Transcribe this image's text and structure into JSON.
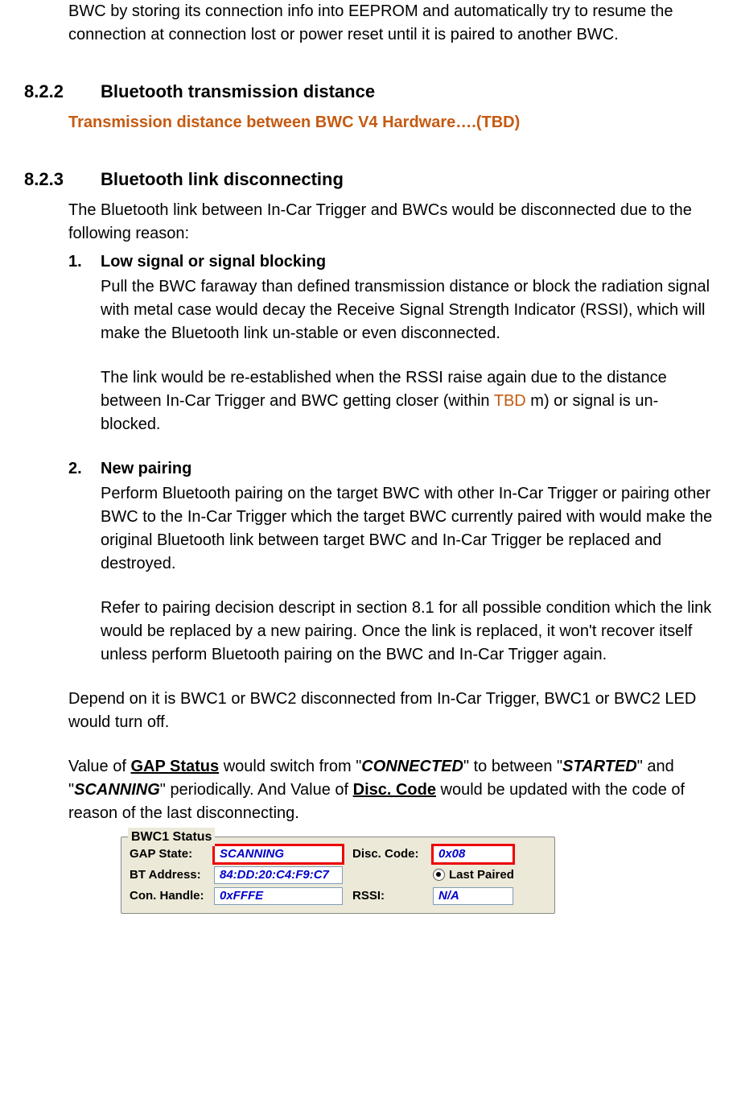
{
  "intro_tail": "BWC by storing its connection info into EEPROM and automatically try to resume the connection at connection lost or power reset until it is paired to another BWC.",
  "s822": {
    "num": "8.2.2",
    "title": "Bluetooth transmission distance",
    "orange": "Transmission distance between BWC V4 Hardware….(TBD)"
  },
  "s823": {
    "num": "8.2.3",
    "title": "Bluetooth link disconnecting",
    "lead": "The Bluetooth link between In-Car Trigger and BWCs would be disconnected due to the following reason:",
    "i1": {
      "num": "1.",
      "title": "Low signal or signal blocking",
      "p1": "Pull the BWC faraway than defined transmission distance or block the radiation signal with metal case would decay the Receive Signal Strength Indicator (RSSI), which will make the Bluetooth link un-stable or even disconnected.",
      "p2a": "The link would be re-established when the RSSI raise again due to the distance between In-Car Trigger and BWC getting closer (within ",
      "p2tbd": "TBD",
      "p2b": " m) or signal is un-blocked."
    },
    "i2": {
      "num": "2.",
      "title": "New pairing",
      "p1": "Perform Bluetooth pairing on the target BWC with other In-Car Trigger or pairing other BWC to the In-Car Trigger which the target BWC currently paired with would make the original Bluetooth link between target BWC and In-Car Trigger be replaced and destroyed.",
      "p2": "Refer to pairing decision descript in section 8.1 for all possible condition which the link would be replaced by a new pairing. Once the link is replaced, it won't recover itself unless perform Bluetooth pairing on the BWC and In-Car Trigger again."
    },
    "after1": "Depend on it is BWC1 or BWC2 disconnected from In-Car Trigger, BWC1 or BWC2 LED would turn off.",
    "after2": {
      "a": "Value of ",
      "gap": "GAP Status",
      "b": " would switch from \"",
      "connected": "CONNECTED",
      "c": "\" to between \"",
      "started": "STARTED",
      "d": "\" and \"",
      "scanning": "SCANNING",
      "e": "\" periodically. And Value of ",
      "disc": "Disc. Code",
      "f": " would be updated with the code of reason of the last disconnecting."
    }
  },
  "status": {
    "legend": "BWC1 Status",
    "l_gap": "GAP State:",
    "v_gap": "SCANNING",
    "l_disc": "Disc. Code:",
    "v_disc": "0x08",
    "l_bt": "BT Address:",
    "v_bt": "84:DD:20:C4:F9:C7",
    "lastpaired": "Last Paired",
    "l_con": "Con. Handle:",
    "v_con": "0xFFFE",
    "l_rssi": "RSSI:",
    "v_rssi": "N/A"
  }
}
